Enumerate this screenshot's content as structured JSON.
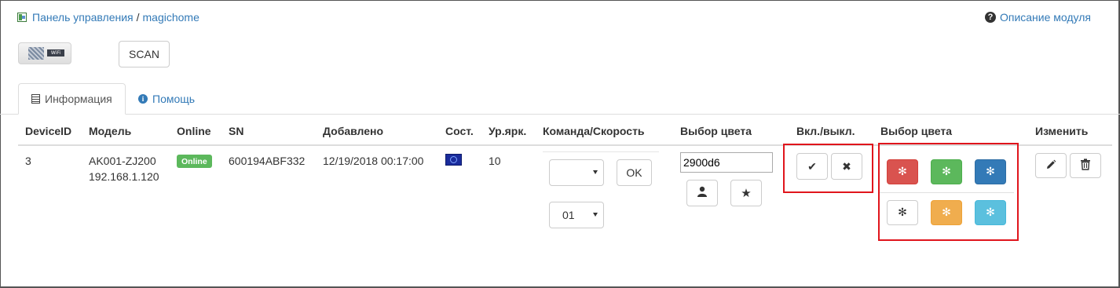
{
  "breadcrumb": {
    "home": "Панель управления",
    "separator": "/",
    "current": "magichome"
  },
  "module_help": {
    "label": "Описание модуля",
    "icon": "question-circle-icon"
  },
  "device_image": {
    "tag": "WiFi"
  },
  "scan_label": "SCAN",
  "tabs": [
    {
      "label": "Информация",
      "icon": "list-icon",
      "active": true
    },
    {
      "label": "Помощь",
      "icon": "info-icon",
      "active": false
    }
  ],
  "table": {
    "headers": {
      "device_id": "DeviceID",
      "model": "Модель",
      "online": "Online",
      "sn": "SN",
      "added": "Добавлено",
      "state": "Сост.",
      "brightness": "Ур.ярк.",
      "command": "Команда/Скорость",
      "color_pick": "Выбор цвета",
      "onoff": "Вкл./выкл.",
      "color_select": "Выбор цвета",
      "edit": "Изменить"
    },
    "row": {
      "device_id": "3",
      "model": "AK001-ZJ200",
      "ip": "192.168.1.120",
      "online": "Online",
      "sn": "600194ABF332",
      "added": "12/19/2018 00:17:00",
      "brightness": "10",
      "command_value": "",
      "speed_value": "01",
      "ok_label": "OK",
      "color_value": "2900d6"
    }
  },
  "colors": {
    "online": "#5cb85c",
    "red": "#d9534f",
    "green": "#5cb85c",
    "blue": "#337ab7",
    "white": "#ffffff",
    "orange": "#f0ad4e",
    "cyan": "#5bc0de",
    "highlight": "#e0151c"
  },
  "color_buttons": [
    {
      "name": "red",
      "glyph": "✻"
    },
    {
      "name": "green",
      "glyph": "✻"
    },
    {
      "name": "blue",
      "glyph": "✻"
    },
    {
      "name": "white",
      "glyph": "✻"
    },
    {
      "name": "orange",
      "glyph": "✻"
    },
    {
      "name": "cyan",
      "glyph": "✻"
    }
  ],
  "icons": {
    "on": "✔",
    "off": "✖",
    "user": "👤",
    "star": "★",
    "edit": "✎",
    "delete": "🗑"
  }
}
